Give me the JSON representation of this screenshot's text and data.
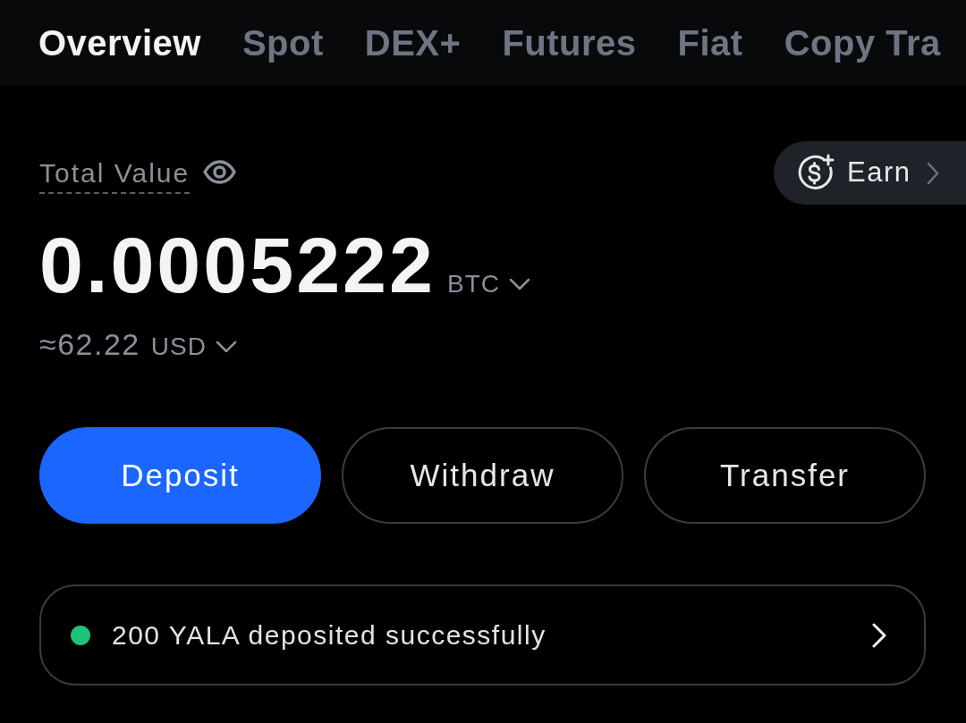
{
  "tabs": [
    {
      "label": "Overview",
      "selected": true
    },
    {
      "label": "Spot",
      "selected": false
    },
    {
      "label": "DEX+",
      "selected": false
    },
    {
      "label": "Futures",
      "selected": false
    },
    {
      "label": "Fiat",
      "selected": false
    },
    {
      "label": "Copy Tra",
      "selected": false
    }
  ],
  "total_value": {
    "label": "Total Value",
    "amount": "0.0005222",
    "unit": "BTC",
    "approx": "≈62.22",
    "approx_unit": "USD"
  },
  "earn_button": {
    "label": "Earn"
  },
  "actions": [
    {
      "label": "Deposit",
      "kind": "primary"
    },
    {
      "label": "Withdraw",
      "kind": "outline"
    },
    {
      "label": "Transfer",
      "kind": "outline"
    }
  ],
  "notice": {
    "text": "200 YALA deposited successfully"
  }
}
